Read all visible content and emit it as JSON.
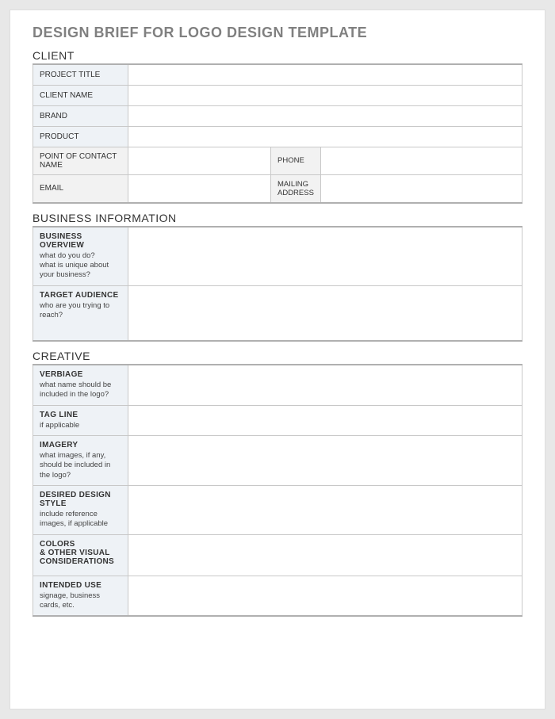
{
  "title": "DESIGN BRIEF FOR LOGO DESIGN TEMPLATE",
  "sections": {
    "client": {
      "heading": "CLIENT",
      "rows": {
        "project_title": {
          "label": "PROJECT TITLE",
          "value": ""
        },
        "client_name": {
          "label": "CLIENT NAME",
          "value": ""
        },
        "brand": {
          "label": "BRAND",
          "value": ""
        },
        "product": {
          "label": "PRODUCT",
          "value": ""
        },
        "poc": {
          "label": "POINT OF CONTACT NAME",
          "value": ""
        },
        "phone": {
          "label": "PHONE",
          "value": ""
        },
        "email": {
          "label": "EMAIL",
          "value": ""
        },
        "mailing": {
          "label": "MAILING ADDRESS",
          "value": ""
        }
      }
    },
    "business": {
      "heading": "BUSINESS INFORMATION",
      "rows": {
        "overview": {
          "label": "BUSINESS OVERVIEW",
          "sub": "what do you do?\nwhat is unique about your business?",
          "value": ""
        },
        "audience": {
          "label": "TARGET AUDIENCE",
          "sub": "who are you trying to reach?",
          "value": ""
        }
      }
    },
    "creative": {
      "heading": "CREATIVE",
      "rows": {
        "verbiage": {
          "label": "VERBIAGE",
          "sub": "what name should be included in the logo?",
          "value": ""
        },
        "tagline": {
          "label": "TAG LINE",
          "sub": "if applicable",
          "value": ""
        },
        "imagery": {
          "label": "IMAGERY",
          "sub": "what images, if any, should be included in the logo?",
          "value": ""
        },
        "style": {
          "label": "DESIRED DESIGN STYLE",
          "sub": "include reference images, if applicable",
          "value": ""
        },
        "colors": {
          "label": "COLORS\n& OTHER VISUAL CONSIDERATIONS",
          "sub": "",
          "value": ""
        },
        "use": {
          "label": "INTENDED USE",
          "sub": "signage, business cards, etc.",
          "value": ""
        }
      }
    }
  }
}
